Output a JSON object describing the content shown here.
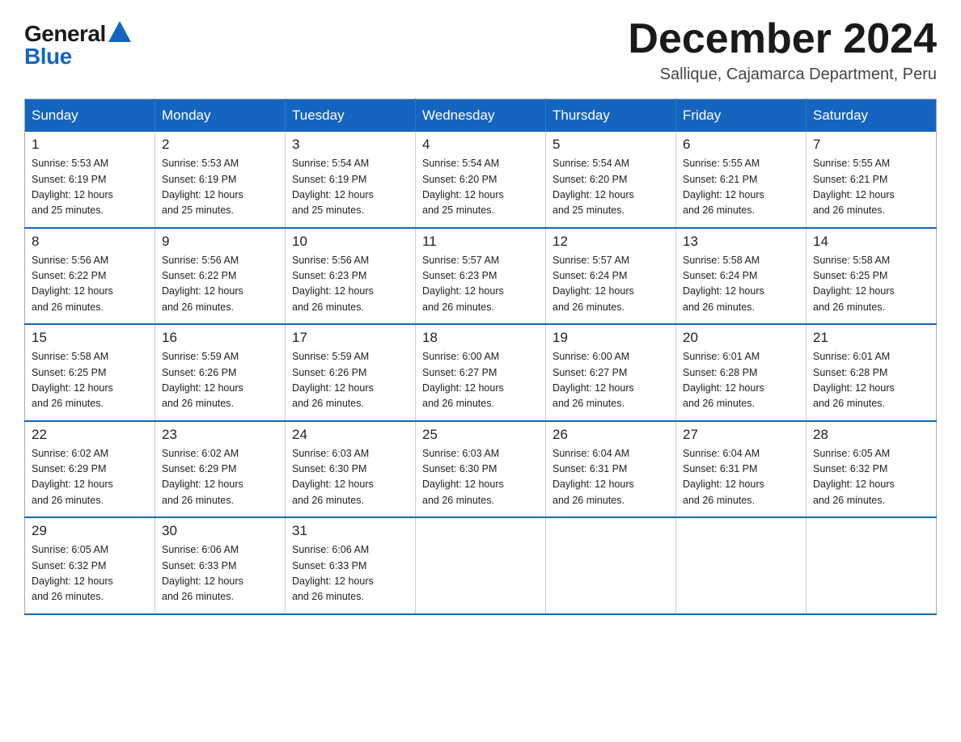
{
  "logo": {
    "general": "General",
    "blue": "Blue"
  },
  "title": "December 2024",
  "subtitle": "Sallique, Cajamarca Department, Peru",
  "days_of_week": [
    "Sunday",
    "Monday",
    "Tuesday",
    "Wednesday",
    "Thursday",
    "Friday",
    "Saturday"
  ],
  "weeks": [
    [
      {
        "day": "1",
        "sunrise": "5:53 AM",
        "sunset": "6:19 PM",
        "daylight": "12 hours and 25 minutes."
      },
      {
        "day": "2",
        "sunrise": "5:53 AM",
        "sunset": "6:19 PM",
        "daylight": "12 hours and 25 minutes."
      },
      {
        "day": "3",
        "sunrise": "5:54 AM",
        "sunset": "6:19 PM",
        "daylight": "12 hours and 25 minutes."
      },
      {
        "day": "4",
        "sunrise": "5:54 AM",
        "sunset": "6:20 PM",
        "daylight": "12 hours and 25 minutes."
      },
      {
        "day": "5",
        "sunrise": "5:54 AM",
        "sunset": "6:20 PM",
        "daylight": "12 hours and 25 minutes."
      },
      {
        "day": "6",
        "sunrise": "5:55 AM",
        "sunset": "6:21 PM",
        "daylight": "12 hours and 26 minutes."
      },
      {
        "day": "7",
        "sunrise": "5:55 AM",
        "sunset": "6:21 PM",
        "daylight": "12 hours and 26 minutes."
      }
    ],
    [
      {
        "day": "8",
        "sunrise": "5:56 AM",
        "sunset": "6:22 PM",
        "daylight": "12 hours and 26 minutes."
      },
      {
        "day": "9",
        "sunrise": "5:56 AM",
        "sunset": "6:22 PM",
        "daylight": "12 hours and 26 minutes."
      },
      {
        "day": "10",
        "sunrise": "5:56 AM",
        "sunset": "6:23 PM",
        "daylight": "12 hours and 26 minutes."
      },
      {
        "day": "11",
        "sunrise": "5:57 AM",
        "sunset": "6:23 PM",
        "daylight": "12 hours and 26 minutes."
      },
      {
        "day": "12",
        "sunrise": "5:57 AM",
        "sunset": "6:24 PM",
        "daylight": "12 hours and 26 minutes."
      },
      {
        "day": "13",
        "sunrise": "5:58 AM",
        "sunset": "6:24 PM",
        "daylight": "12 hours and 26 minutes."
      },
      {
        "day": "14",
        "sunrise": "5:58 AM",
        "sunset": "6:25 PM",
        "daylight": "12 hours and 26 minutes."
      }
    ],
    [
      {
        "day": "15",
        "sunrise": "5:58 AM",
        "sunset": "6:25 PM",
        "daylight": "12 hours and 26 minutes."
      },
      {
        "day": "16",
        "sunrise": "5:59 AM",
        "sunset": "6:26 PM",
        "daylight": "12 hours and 26 minutes."
      },
      {
        "day": "17",
        "sunrise": "5:59 AM",
        "sunset": "6:26 PM",
        "daylight": "12 hours and 26 minutes."
      },
      {
        "day": "18",
        "sunrise": "6:00 AM",
        "sunset": "6:27 PM",
        "daylight": "12 hours and 26 minutes."
      },
      {
        "day": "19",
        "sunrise": "6:00 AM",
        "sunset": "6:27 PM",
        "daylight": "12 hours and 26 minutes."
      },
      {
        "day": "20",
        "sunrise": "6:01 AM",
        "sunset": "6:28 PM",
        "daylight": "12 hours and 26 minutes."
      },
      {
        "day": "21",
        "sunrise": "6:01 AM",
        "sunset": "6:28 PM",
        "daylight": "12 hours and 26 minutes."
      }
    ],
    [
      {
        "day": "22",
        "sunrise": "6:02 AM",
        "sunset": "6:29 PM",
        "daylight": "12 hours and 26 minutes."
      },
      {
        "day": "23",
        "sunrise": "6:02 AM",
        "sunset": "6:29 PM",
        "daylight": "12 hours and 26 minutes."
      },
      {
        "day": "24",
        "sunrise": "6:03 AM",
        "sunset": "6:30 PM",
        "daylight": "12 hours and 26 minutes."
      },
      {
        "day": "25",
        "sunrise": "6:03 AM",
        "sunset": "6:30 PM",
        "daylight": "12 hours and 26 minutes."
      },
      {
        "day": "26",
        "sunrise": "6:04 AM",
        "sunset": "6:31 PM",
        "daylight": "12 hours and 26 minutes."
      },
      {
        "day": "27",
        "sunrise": "6:04 AM",
        "sunset": "6:31 PM",
        "daylight": "12 hours and 26 minutes."
      },
      {
        "day": "28",
        "sunrise": "6:05 AM",
        "sunset": "6:32 PM",
        "daylight": "12 hours and 26 minutes."
      }
    ],
    [
      {
        "day": "29",
        "sunrise": "6:05 AM",
        "sunset": "6:32 PM",
        "daylight": "12 hours and 26 minutes."
      },
      {
        "day": "30",
        "sunrise": "6:06 AM",
        "sunset": "6:33 PM",
        "daylight": "12 hours and 26 minutes."
      },
      {
        "day": "31",
        "sunrise": "6:06 AM",
        "sunset": "6:33 PM",
        "daylight": "12 hours and 26 minutes."
      },
      null,
      null,
      null,
      null
    ]
  ],
  "labels": {
    "sunrise": "Sunrise:",
    "sunset": "Sunset:",
    "daylight": "Daylight:"
  }
}
